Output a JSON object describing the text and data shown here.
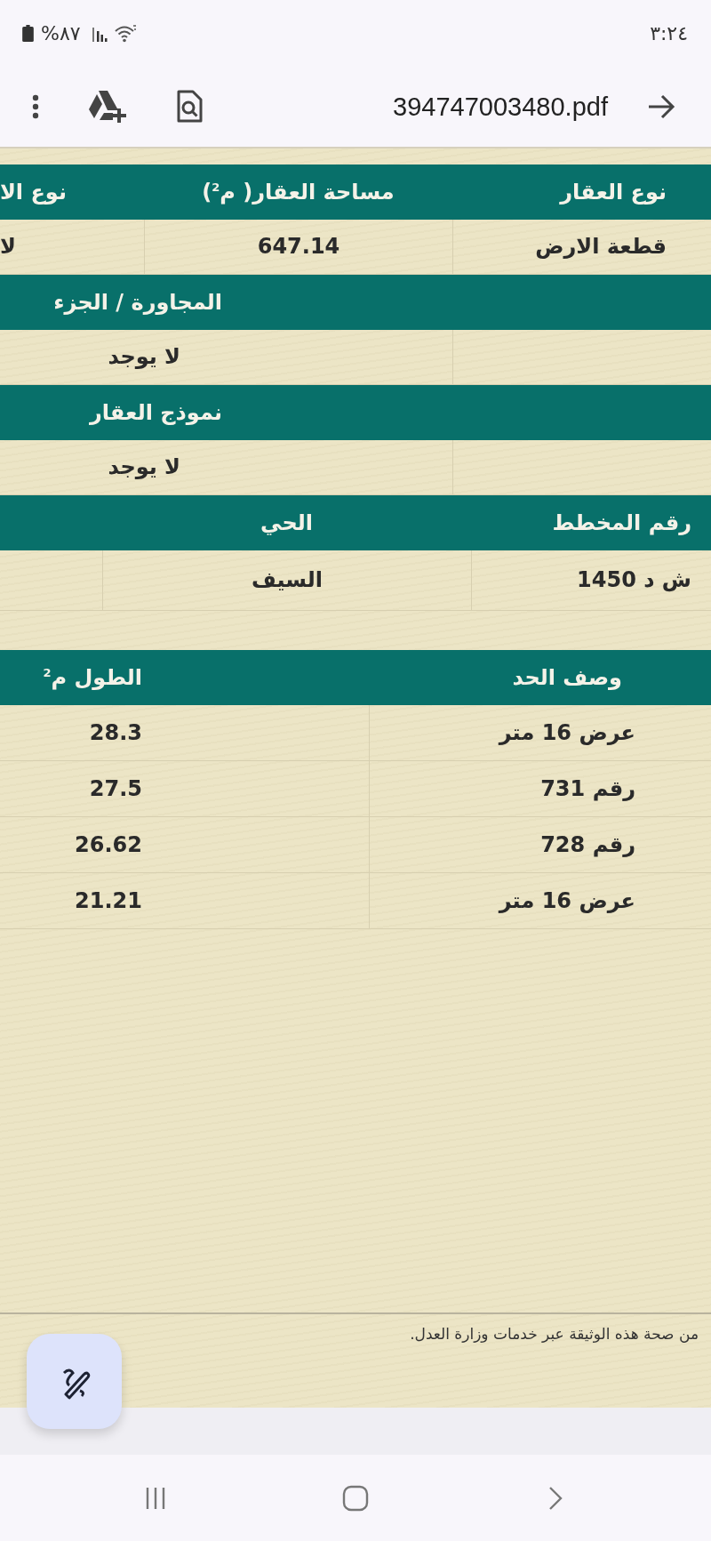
{
  "status_bar": {
    "time": "٣:٢٤",
    "battery": "%٨٧"
  },
  "toolbar": {
    "title": "394747003480.pdf"
  },
  "document": {
    "property_table": {
      "headers": [
        "نوع العقار",
        "مساحة العقار( م$^{2}$)",
        "نوع الا"
      ],
      "row": [
        "قطعة الارض",
        "647.14",
        "لا"
      ]
    },
    "adjacency": {
      "label": "المجاورة / الجزء",
      "value": "لا يوجد"
    },
    "model": {
      "label": "نموذج العقار",
      "value": "لا يوجد"
    },
    "location_table": {
      "headers": [
        "رقم المخطط",
        "الحي"
      ],
      "row": [
        "ش د 1450",
        "السيف"
      ]
    },
    "boundaries_table": {
      "headers": [
        "وصف الحد",
        "الطول م$^{2}$"
      ],
      "rows": [
        [
          "عرض 16 متر",
          "28.3"
        ],
        [
          "رقم 731",
          "27.5"
        ],
        [
          "رقم 728",
          "26.62"
        ],
        [
          "عرض 16 متر",
          "21.21"
        ]
      ]
    },
    "footer_note": "من صحة هذه الوثيقة عبر خدمات وزارة العدل."
  }
}
